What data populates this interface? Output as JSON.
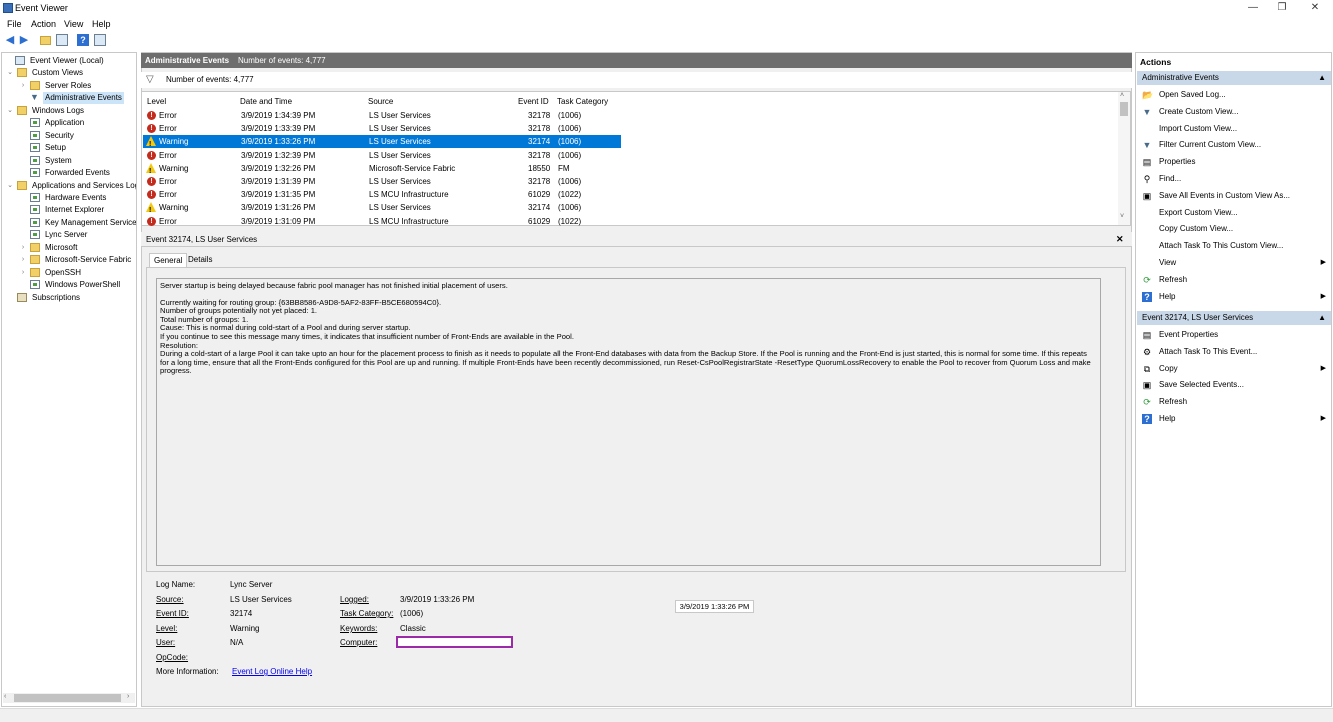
{
  "window": {
    "title": "Event Viewer",
    "minimize": "—",
    "maximize": "❐",
    "close": "✕"
  },
  "menu": [
    "File",
    "Action",
    "View",
    "Help"
  ],
  "tree": [
    {
      "label": "Event Viewer (Local)",
      "icon": "computer-icon",
      "depth": 0,
      "expander": ""
    },
    {
      "label": "Custom Views",
      "icon": "folder-icon",
      "depth": 1,
      "expander": "⌄"
    },
    {
      "label": "Server Roles",
      "icon": "folder-icon",
      "depth": 2,
      "expander": "›"
    },
    {
      "label": "Administrative Events",
      "icon": "filter-icon",
      "depth": 2,
      "expander": "",
      "selected": true
    },
    {
      "label": "Windows Logs",
      "icon": "folder-icon",
      "depth": 1,
      "expander": "⌄"
    },
    {
      "label": "Application",
      "icon": "log-icon",
      "depth": 2,
      "expander": ""
    },
    {
      "label": "Security",
      "icon": "log-icon",
      "depth": 2,
      "expander": ""
    },
    {
      "label": "Setup",
      "icon": "log-icon",
      "depth": 2,
      "expander": ""
    },
    {
      "label": "System",
      "icon": "log-icon",
      "depth": 2,
      "expander": ""
    },
    {
      "label": "Forwarded Events",
      "icon": "log-icon",
      "depth": 2,
      "expander": ""
    },
    {
      "label": "Applications and Services Log",
      "icon": "folder-icon",
      "depth": 1,
      "expander": "⌄"
    },
    {
      "label": "Hardware Events",
      "icon": "log-icon",
      "depth": 2,
      "expander": ""
    },
    {
      "label": "Internet Explorer",
      "icon": "log-icon",
      "depth": 2,
      "expander": ""
    },
    {
      "label": "Key Management Service",
      "icon": "log-icon",
      "depth": 2,
      "expander": ""
    },
    {
      "label": "Lync Server",
      "icon": "log-icon",
      "depth": 2,
      "expander": ""
    },
    {
      "label": "Microsoft",
      "icon": "folder-icon",
      "depth": 2,
      "expander": "›"
    },
    {
      "label": "Microsoft-Service Fabric",
      "icon": "folder-icon",
      "depth": 2,
      "expander": "›"
    },
    {
      "label": "OpenSSH",
      "icon": "folder-icon",
      "depth": 2,
      "expander": "›"
    },
    {
      "label": "Windows PowerShell",
      "icon": "log-icon",
      "depth": 2,
      "expander": ""
    },
    {
      "label": "Subscriptions",
      "icon": "subscriptions-icon",
      "depth": 1,
      "expander": ""
    }
  ],
  "center": {
    "view_title": "Administrative Events",
    "count_header": "Number of events: 4,777",
    "filter_text": "Number of events: 4,777",
    "columns": [
      "Level",
      "Date and Time",
      "Source",
      "Event ID",
      "Task Category"
    ],
    "events": [
      {
        "level": "Error",
        "date": "3/9/2019 1:34:39 PM",
        "source": "LS User Services",
        "id": "32178",
        "task": "(1006)"
      },
      {
        "level": "Error",
        "date": "3/9/2019 1:33:39 PM",
        "source": "LS User Services",
        "id": "32178",
        "task": "(1006)"
      },
      {
        "level": "Warning",
        "date": "3/9/2019 1:33:26 PM",
        "source": "LS User Services",
        "id": "32174",
        "task": "(1006)",
        "selected": true
      },
      {
        "level": "Error",
        "date": "3/9/2019 1:32:39 PM",
        "source": "LS User Services",
        "id": "32178",
        "task": "(1006)"
      },
      {
        "level": "Warning",
        "date": "3/9/2019 1:32:26 PM",
        "source": "Microsoft-Service Fabric",
        "id": "18550",
        "task": "FM"
      },
      {
        "level": "Error",
        "date": "3/9/2019 1:31:39 PM",
        "source": "LS User Services",
        "id": "32178",
        "task": "(1006)"
      },
      {
        "level": "Error",
        "date": "3/9/2019 1:31:35 PM",
        "source": "LS MCU Infrastructure",
        "id": "61029",
        "task": "(1022)"
      },
      {
        "level": "Warning",
        "date": "3/9/2019 1:31:26 PM",
        "source": "LS User Services",
        "id": "32174",
        "task": "(1006)"
      },
      {
        "level": "Error",
        "date": "3/9/2019 1:31:09 PM",
        "source": "LS MCU Infrastructure",
        "id": "61029",
        "task": "(1022)"
      }
    ]
  },
  "detail": {
    "title": "Event 32174, LS User Services",
    "close": "✕",
    "tabs": [
      "General",
      "Details"
    ],
    "description": [
      "Server startup is being delayed because fabric pool manager has not finished initial placement of users.",
      "",
      "Currently waiting for routing group: {63BB8586-A9D8-5AF2-83FF-B5CE680594C0}.",
      "Number of groups potentially not yet placed: 1.",
      "Total number of groups: 1.",
      "Cause: This is normal during cold-start of a Pool and during server startup.",
      "If you continue to see this message many times, it indicates that insufficient number of Front-Ends are available in the Pool.",
      "Resolution:",
      "During a cold-start of a large Pool it can take upto an hour for the placement process to finish as it needs to populate all the Front-End databases with data from the Backup Store. If the Pool is running and the Front-End is just started, this is normal for some time. If this repeats for a long time, ensure that all the Front-Ends configured for this Pool are up and running. If multiple Front-Ends have been recently decommissioned, run Reset-CsPoolRegistrarState -ResetType QuorumLossRecovery to enable the Pool to recover from Quorum Loss and make progress."
    ],
    "fields": {
      "log_name_label": "Log Name:",
      "log_name": "Lync Server",
      "source_label": "Source:",
      "source": "LS User Services",
      "event_id_label": "Event ID:",
      "event_id": "32174",
      "level_label": "Level:",
      "level": "Warning",
      "user_label": "User:",
      "user": "N/A",
      "opcode_label": "OpCode:",
      "more_info_label": "More Information:",
      "more_info_link": "Event Log Online Help",
      "logged_label": "Logged:",
      "logged": "3/9/2019 1:33:26 PM",
      "task_label": "Task Category:",
      "task": "(1006)",
      "keywords_label": "Keywords:",
      "keywords": "Classic",
      "computer_label": "Computer:",
      "computer": "",
      "logged_popup": "3/9/2019 1:33:26 PM"
    }
  },
  "actions": {
    "title": "Actions",
    "sections": [
      {
        "title": "Administrative Events",
        "items": [
          {
            "label": "Open Saved Log...",
            "icon": "open-folder-icon",
            "glyph": "📂",
            "sub": false
          },
          {
            "label": "Create Custom View...",
            "icon": "filter-icon",
            "glyph": "▼",
            "sub": false
          },
          {
            "label": "Import Custom View...",
            "icon": "",
            "glyph": "",
            "sub": false
          },
          {
            "label": "Filter Current Custom View...",
            "icon": "filter-icon",
            "glyph": "▼",
            "sub": false
          },
          {
            "label": "Properties",
            "icon": "properties-icon",
            "glyph": "▤",
            "sub": false
          },
          {
            "label": "Find...",
            "icon": "find-icon",
            "glyph": "⚲",
            "sub": false
          },
          {
            "label": "Save All Events in Custom View As...",
            "icon": "save-icon",
            "glyph": "▣",
            "sub": false
          },
          {
            "label": "Export Custom View...",
            "icon": "",
            "glyph": "",
            "sub": false
          },
          {
            "label": "Copy Custom View...",
            "icon": "",
            "glyph": "",
            "sub": false
          },
          {
            "label": "Attach Task To This Custom View...",
            "icon": "",
            "glyph": "",
            "sub": false
          },
          {
            "label": "View",
            "icon": "",
            "glyph": "",
            "sub": true
          },
          {
            "label": "Refresh",
            "icon": "refresh-icon",
            "glyph": "⟳",
            "sub": false
          },
          {
            "label": "Help",
            "icon": "help-icon",
            "glyph": "?",
            "sub": true
          }
        ]
      },
      {
        "title": "Event 32174, LS User Services",
        "items": [
          {
            "label": "Event Properties",
            "icon": "properties-icon",
            "glyph": "▤",
            "sub": false
          },
          {
            "label": "Attach Task To This Event...",
            "icon": "task-icon",
            "glyph": "⚙",
            "sub": false
          },
          {
            "label": "Copy",
            "icon": "copy-icon",
            "glyph": "⧉",
            "sub": true
          },
          {
            "label": "Save Selected Events...",
            "icon": "save-icon",
            "glyph": "▣",
            "sub": false
          },
          {
            "label": "Refresh",
            "icon": "refresh-icon",
            "glyph": "⟳",
            "sub": false
          },
          {
            "label": "Help",
            "icon": "help-icon",
            "glyph": "?",
            "sub": true
          }
        ]
      }
    ]
  }
}
